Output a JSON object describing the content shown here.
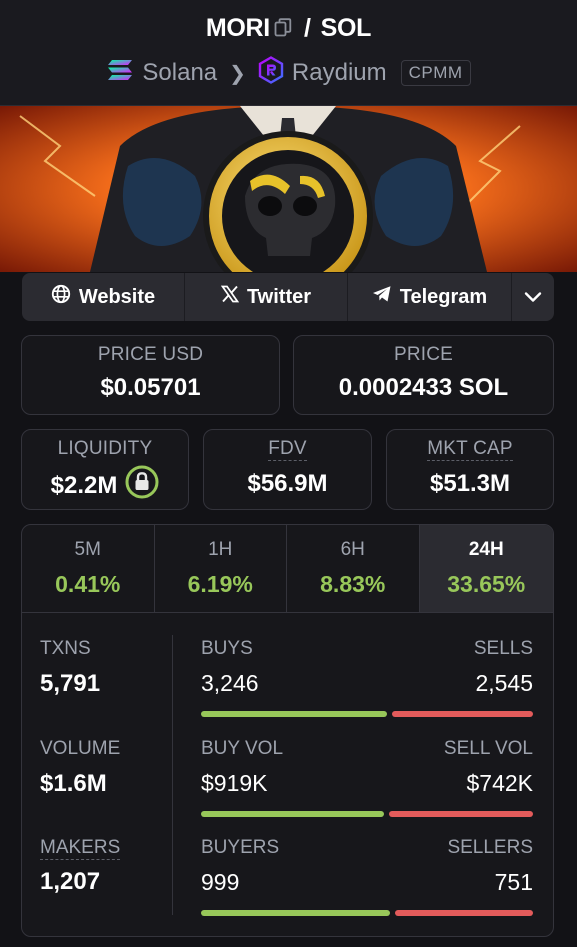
{
  "header": {
    "base": "MORI",
    "slash": "/",
    "quote": "SOL",
    "chain": "Solana",
    "dex": "Raydium",
    "badge": "CPMM"
  },
  "links": {
    "website": "Website",
    "twitter": "Twitter",
    "telegram": "Telegram"
  },
  "price": {
    "usd_label": "PRICE USD",
    "usd_value": "$0.05701",
    "native_label": "PRICE",
    "native_value": "0.0002433 SOL"
  },
  "metrics": {
    "liquidity_label": "LIQUIDITY",
    "liquidity_value": "$2.2M",
    "fdv_label": "FDV",
    "fdv_value": "$56.9M",
    "mcap_label": "MKT CAP",
    "mcap_value": "$51.3M"
  },
  "timeframes": [
    {
      "label": "5M",
      "value": "0.41%"
    },
    {
      "label": "1H",
      "value": "6.19%"
    },
    {
      "label": "6H",
      "value": "8.83%"
    },
    {
      "label": "24H",
      "value": "33.65%"
    }
  ],
  "stats": {
    "txns_label": "TXNS",
    "txns_value": "5,791",
    "volume_label": "VOLUME",
    "volume_value": "$1.6M",
    "makers_label": "MAKERS",
    "makers_value": "1,207",
    "buys_label": "BUYS",
    "buys_value": "3,246",
    "sells_label": "SELLS",
    "sells_value": "2,545",
    "buyvol_label": "BUY VOL",
    "buyvol_value": "$919K",
    "sellvol_label": "SELL VOL",
    "sellvol_value": "$742K",
    "buyers_label": "BUYERS",
    "buyers_value": "999",
    "sellers_label": "SELLERS",
    "sellers_value": "751"
  },
  "colors": {
    "positive": "#98c75a",
    "negative": "#e35b5b",
    "background": "#121216",
    "panel": "#17171b"
  },
  "icons": {
    "copy": "copy-icon",
    "solana": "solana-logo",
    "raydium": "raydium-logo",
    "globe": "globe-icon",
    "x": "x-logo-icon",
    "telegram": "telegram-icon",
    "chevron": "chevron-down-icon",
    "lock": "lock-icon"
  }
}
